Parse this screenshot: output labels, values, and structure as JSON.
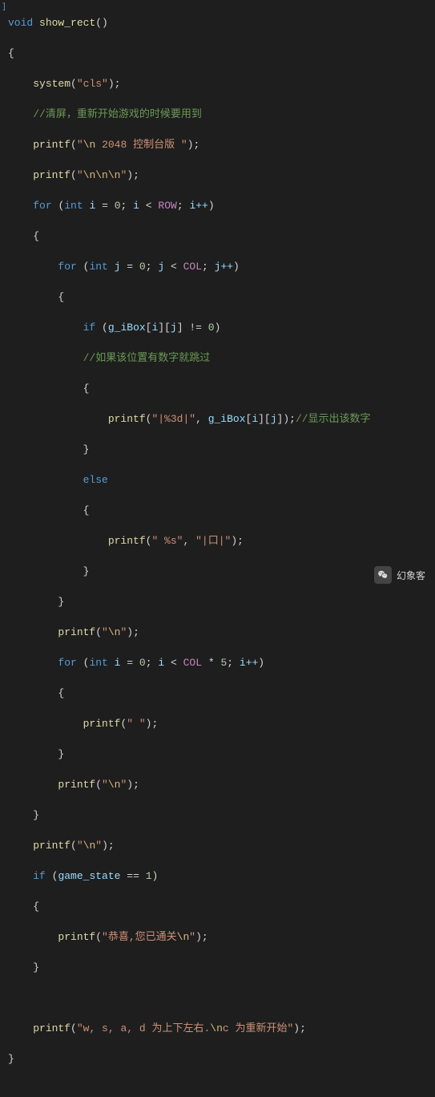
{
  "code": {
    "l1": {
      "return": "void",
      "fn": "show_rect"
    },
    "l3_fn": "system",
    "l3_str": "\"cls\"",
    "l4_comment": "//清屏，重新开始游戏的时候要用到",
    "l5_fn": "printf",
    "l5_s1": "\"",
    "l5_e1": "\\n",
    "l5_s2": " 2048 控制台版 \"",
    "l6_fn": "printf",
    "l6_s1": "\"",
    "l6_e1": "\\n\\n\\n",
    "l6_s2": "\"",
    "l7_for": "for",
    "l7_int": "int",
    "l7_var": "i",
    "l7_z": "0",
    "l7_row": "ROW",
    "l7_inc": "i++",
    "l9_for": "for",
    "l9_int": "int",
    "l9_var": "j",
    "l9_z": "0",
    "l9_col": "COL",
    "l9_inc": "j++",
    "l11_if": "if",
    "l11_arr": "g_iBox",
    "l11_i": "i",
    "l11_j": "j",
    "l11_z": "0",
    "l12_comment": "//如果该位置有数字就跳过",
    "l14_fn": "printf",
    "l14_s": "\"|%3d|\"",
    "l14_arr": "g_iBox",
    "l14_i": "i",
    "l14_j": "j",
    "l14_comment": "//显示出该数字",
    "l16_else": "else",
    "l18_fn": "printf",
    "l18_s1": "\" %s\"",
    "l18_s2": "\"|口|\"",
    "l21_fn": "printf",
    "l21_s": "\"",
    "l21_e": "\\n",
    "l21_s2": "\"",
    "l22_for": "for",
    "l22_int": "int",
    "l22_var": "i",
    "l22_z": "0",
    "l22_col": "COL",
    "l22_mul": "5",
    "l22_inc": "i++",
    "l24_fn": "printf",
    "l24_s": "\" \"",
    "l26_fn": "printf",
    "l26_s": "\"",
    "l26_e": "\\n",
    "l26_s2": "\"",
    "l28_fn": "printf",
    "l28_s": "\"",
    "l28_e": "\\n",
    "l28_s2": "\"",
    "l29_if": "if",
    "l29_var": "game_state",
    "l29_one": "1",
    "l31_fn": "printf",
    "l31_s1": "\"恭喜,您已通关",
    "l31_e": "\\n",
    "l31_s2": "\"",
    "l34_fn": "printf",
    "l34_s1": "\"w, s, a, d 为上下左右.",
    "l34_e": "\\n",
    "l34_s2": "c 为重新开始\""
  },
  "watermark": {
    "text": "幻象客"
  }
}
